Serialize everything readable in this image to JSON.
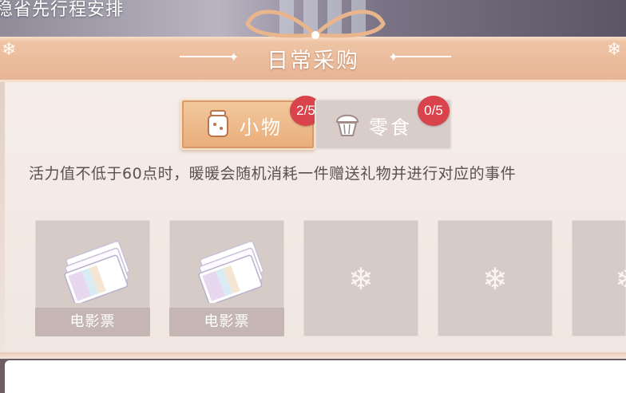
{
  "header": {
    "top_text": "稳省先行程安排",
    "title": "日常采购"
  },
  "tabs": [
    {
      "label": "小物",
      "badge": "2/5",
      "icon": "jar-icon",
      "active": true
    },
    {
      "label": "零食",
      "badge": "0/5",
      "icon": "cupcake-icon",
      "active": false
    }
  ],
  "description": "活力值不低于60点时，暖暖会随机消耗一件赠送礼物并进行对应的事件",
  "slots": [
    {
      "label": "电影票",
      "icon": "movie-ticket-icon"
    },
    {
      "label": "电影票",
      "icon": "movie-ticket-icon"
    },
    {
      "label": "",
      "icon": "snowflake-icon"
    },
    {
      "label": "",
      "icon": "snowflake-icon"
    },
    {
      "label": "",
      "icon": "snowflake-icon"
    }
  ],
  "colors": {
    "accent": "#e9ad7b",
    "badge": "#d9434c",
    "slot_bg": "#d7cbc8",
    "text": "#5d5050"
  }
}
